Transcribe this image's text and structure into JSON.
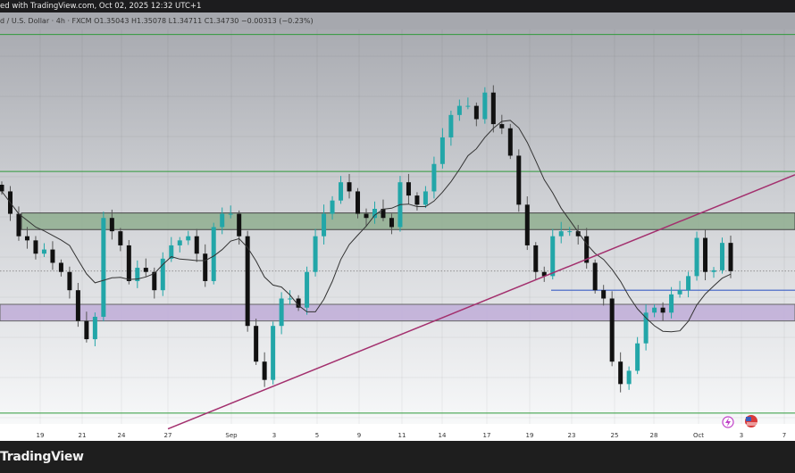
{
  "header": {
    "text": "ed with TradingView.com, Oct 02, 2025 12:32 UTC+1"
  },
  "symbol_info": {
    "text": "d / U.S. Dollar · 4h · FXCM  O1.35043  H1.35078  L1.34711  C1.34730  −0.00313 (−0.23%)"
  },
  "footer": {
    "logo_text": "TradingView"
  },
  "colors": {
    "up": "#22a6a8",
    "down": "#111111",
    "ma": "#333333",
    "trendline": "#a3306e",
    "support_zone": "#8fae8f",
    "demand_zone": "#c1afd8",
    "range_line": "#2f9a3a",
    "blue_line": "#3c5fc4"
  },
  "icons": [
    "lightning-event-icon",
    "us-flag-event-icon"
  ],
  "chart_data": {
    "type": "candlestick",
    "symbol_open": 1.35043,
    "symbol_high": 1.35078,
    "symbol_low": 1.34711,
    "symbol_close": 1.3473,
    "x_tick_labels": [
      "19",
      "21",
      "24",
      "27",
      "Sep",
      "3",
      "5",
      "9",
      "11",
      "14",
      "17",
      "19",
      "23",
      "25",
      "28",
      "Oct",
      "3",
      "7"
    ],
    "closes": [
      1.3569,
      1.3542,
      1.3515,
      1.351,
      1.3494,
      1.3499,
      1.3483,
      1.3472,
      1.345,
      1.3413,
      1.3391,
      1.3418,
      1.3537,
      1.3521,
      1.3504,
      1.3461,
      1.3477,
      1.3472,
      1.345,
      1.3488,
      1.3504,
      1.351,
      1.3515,
      1.3494,
      1.3461,
      1.3526,
      1.3542,
      1.3542,
      1.3515,
      1.3407,
      1.3364,
      1.3342,
      1.3407,
      1.344,
      1.344,
      1.3429,
      1.3472,
      1.3515,
      1.3542,
      1.3558,
      1.358,
      1.3569,
      1.3542,
      1.3537,
      1.3548,
      1.3537,
      1.3526,
      1.358,
      1.3564,
      1.3553,
      1.3569,
      1.3602,
      1.3634,
      1.3661,
      1.3672,
      1.3672,
      1.3656,
      1.3688,
      1.365,
      1.3645,
      1.3612,
      1.3553,
      1.3504,
      1.3472,
      1.3467,
      1.3515,
      1.3521,
      1.3521,
      1.3515,
      1.3483,
      1.345,
      1.344,
      1.3364,
      1.3337,
      1.3353,
      1.3386,
      1.3423,
      1.3429,
      1.3423,
      1.3445,
      1.345,
      1.3467,
      1.3513,
      1.3472,
      1.3474,
      1.3507,
      1.3473
    ],
    "price_range": [
      1.3289,
      1.3764
    ],
    "levels": {
      "upper_line": 1.3758,
      "mid_line": 1.3593,
      "lower_line": 1.3302,
      "green_zone": [
        1.3523,
        1.3543
      ],
      "purple_zone": [
        1.3413,
        1.3433
      ],
      "blue_line": 1.345
    },
    "trendline": [
      1.3283,
      1.3589
    ],
    "moving_average": true,
    "grid": true
  }
}
